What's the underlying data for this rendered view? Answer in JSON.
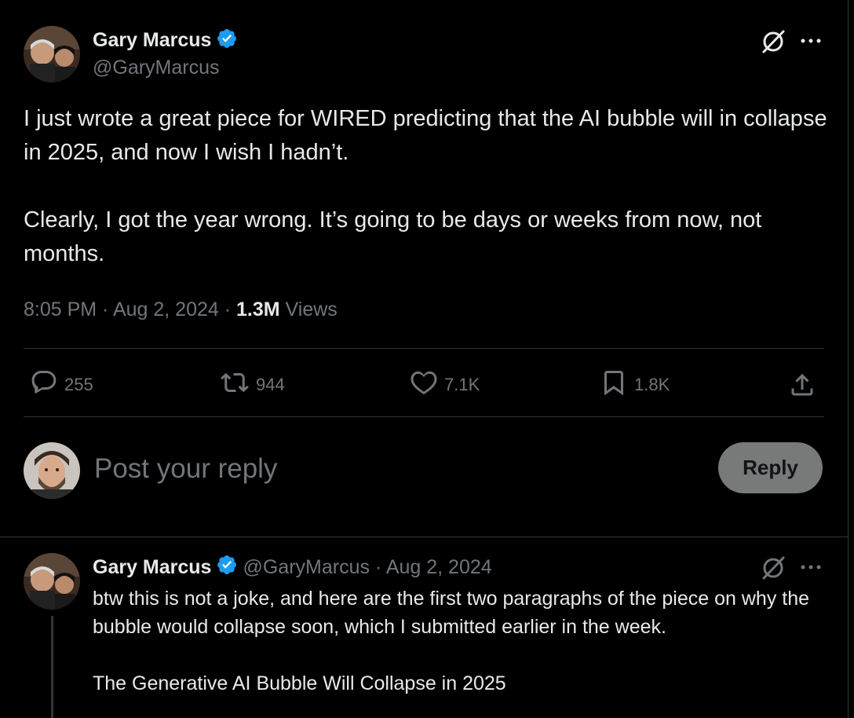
{
  "main_post": {
    "author_name": "Gary Marcus",
    "handle": "@GaryMarcus",
    "paragraphs": [
      "I just wrote a great piece for WIRED predicting that the AI bubble will in collapse in 2025, and now I wish I hadn’t.",
      "Clearly, I got the year wrong. It’s going to be days or weeks from now, not months."
    ],
    "timestamp": "8:05 PM · Aug 2, 2024 · ",
    "views_count": "1.3M",
    "views_label": " Views",
    "stats": {
      "replies": "255",
      "reposts": "944",
      "likes": "7.1K",
      "bookmarks": "1.8K"
    }
  },
  "composer": {
    "placeholder": "Post your reply",
    "reply_button": "Reply"
  },
  "reply_post": {
    "author_name": "Gary Marcus",
    "meta": "@GaryMarcus · Aug 2, 2024",
    "lines": [
      "btw this is not a joke, and here are the first two paragraphs of the piece on why the bubble would collapse soon, which I submitted earlier in the week.",
      "The Generative AI Bubble Will Collapse in 2025"
    ]
  },
  "colors": {
    "background": "#000000",
    "text": "#e7e9ea",
    "muted": "#71767b",
    "verified": "#1d9bf0",
    "divider": "#2f3336",
    "reply_button_bg": "#787a7a"
  },
  "icons": [
    "verified-badge-icon",
    "grok-icon",
    "more-icon",
    "reply-icon",
    "repost-icon",
    "like-icon",
    "bookmark-icon",
    "share-icon"
  ]
}
